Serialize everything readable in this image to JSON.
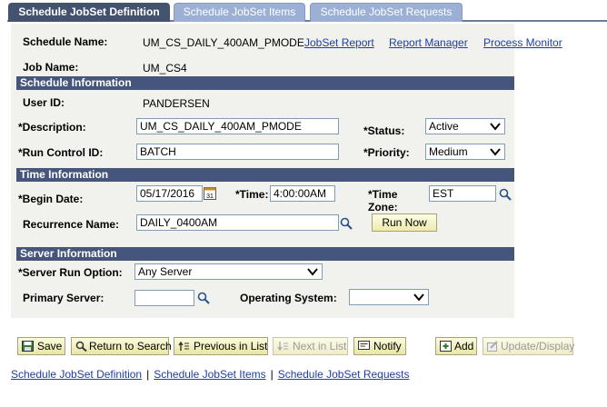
{
  "tabs": [
    {
      "label": "Schedule JobSet Definition",
      "active": true
    },
    {
      "label": "Schedule JobSet Items",
      "active": false
    },
    {
      "label": "Schedule JobSet Requests",
      "active": false
    }
  ],
  "header": {
    "schedule_name_label": "Schedule Name:",
    "schedule_name_value": "UM_CS_DAILY_400AM_PMODE",
    "job_name_label": "Job Name:",
    "job_name_value": "UM_CS4",
    "links": [
      "JobSet Report",
      "Report Manager",
      "Process Monitor"
    ]
  },
  "schedule_info": {
    "title": "Schedule Information",
    "user_id_label": "User ID:",
    "user_id_value": "PANDERSEN",
    "description_label": "*Description:",
    "description_value": "UM_CS_DAILY_400AM_PMODE",
    "status_label": "*Status:",
    "status_value": "Active",
    "run_control_label": "*Run Control ID:",
    "run_control_value": "BATCH",
    "priority_label": "*Priority:",
    "priority_value": "Medium"
  },
  "time_info": {
    "title": "Time Information",
    "begin_date_label": "*Begin Date:",
    "begin_date_value": "05/17/2016",
    "time_label": "*Time:",
    "time_value": "4:00:00AM",
    "time_zone_label_1": "*Time",
    "time_zone_label_2": "Zone:",
    "time_zone_value": "EST",
    "recurrence_label": "Recurrence Name:",
    "recurrence_value": "DAILY_0400AM",
    "run_now_label": "Run Now"
  },
  "server_info": {
    "title": "Server Information",
    "run_option_label": "*Server Run Option:",
    "run_option_value": "Any Server",
    "primary_server_label": "Primary Server:",
    "primary_server_value": "",
    "os_label": "Operating System:",
    "os_value": ""
  },
  "toolbar": {
    "save": "Save",
    "return_to_search": "Return to Search",
    "previous_in_list": "Previous in List",
    "next_in_list": "Next in List",
    "notify": "Notify",
    "add": "Add",
    "update_display": "Update/Display"
  },
  "footer_links": [
    "Schedule JobSet Definition",
    "Schedule JobSet Items",
    "Schedule JobSet Requests"
  ]
}
